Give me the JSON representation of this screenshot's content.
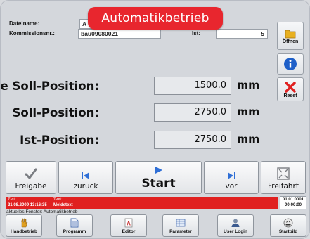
{
  "banner": {
    "title": "Automatikbetrieb"
  },
  "header": {
    "dateiname_label": "Dateiname:",
    "dateiname_value": "A",
    "kommission_label": "Kommissionsnr.:",
    "kommission_value": "bau09080021",
    "ist_label": "Ist:",
    "ist_value": "5"
  },
  "side": {
    "open_label": "Öffnen",
    "reset_label": "Reset"
  },
  "positions": [
    {
      "label": "neue Soll-Position:",
      "value": "1500.0",
      "unit": "mm"
    },
    {
      "label": "Soll-Position:",
      "value": "2750.0",
      "unit": "mm"
    },
    {
      "label": "Ist-Position:",
      "value": "2750.0",
      "unit": "mm"
    }
  ],
  "controls": {
    "freigabe": "Freigabe",
    "zurueck": "zurück",
    "start": "Start",
    "vor": "vor",
    "freifahrt": "Freifahrt"
  },
  "status": {
    "zeit_label": "Zeit:",
    "zeit_value": "21.08.2009 13:16:35",
    "text_label": "Text:",
    "text_value": "Meldetext",
    "date": "01.01.0001",
    "time": "00:00:00"
  },
  "current_window": "aktuelles Fenster: Automatikbetrieb",
  "bottom": [
    {
      "label": "Handbetrieb",
      "icon": "hand-icon"
    },
    {
      "label": "Programm",
      "icon": "document-icon"
    },
    {
      "label": "Editor",
      "icon": "editor-icon"
    },
    {
      "label": "Parameter",
      "icon": "parameter-icon"
    },
    {
      "label": "User Login",
      "icon": "user-icon"
    },
    {
      "label": "Startbild",
      "icon": "startbild-icon"
    }
  ],
  "colors": {
    "banner": "#e8262e",
    "status_bar": "#e02020",
    "nav_blue": "#2f6fd6"
  }
}
